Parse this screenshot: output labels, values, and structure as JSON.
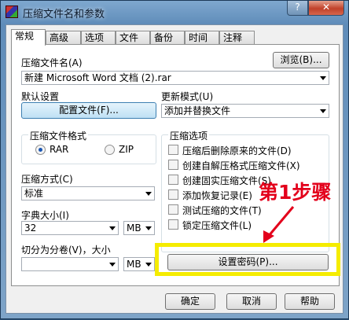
{
  "window": {
    "title": "压缩文件名和参数",
    "help_label": "?",
    "close_label": "✕"
  },
  "tabs": [
    {
      "label": "常规",
      "active": true
    },
    {
      "label": "高级"
    },
    {
      "label": "选项"
    },
    {
      "label": "文件"
    },
    {
      "label": "备份"
    },
    {
      "label": "时间"
    },
    {
      "label": "注释"
    }
  ],
  "general": {
    "archive_name_label": "压缩文件名(A)",
    "browse_label": "浏览(B)...",
    "archive_name_value": "新建 Microsoft Word 文档 (2).rar",
    "default_settings_label": "默认设置",
    "profiles_label": "配置文件(F)...",
    "update_mode_label": "更新模式(U)",
    "update_mode_value": "添加并替换文件",
    "format_group_title": "压缩文件格式",
    "format_rar": "RAR",
    "format_zip": "ZIP",
    "options_group_title": "压缩选项",
    "options": [
      {
        "label": "压缩后删除原来的文件(D)",
        "checked": false
      },
      {
        "label": "创建自解压格式压缩文件(X)",
        "checked": false
      },
      {
        "label": "创建固实压缩文件(S)",
        "checked": false
      },
      {
        "label": "添加恢复记录(E)",
        "checked": false
      },
      {
        "label": "测试压缩的文件(T)",
        "checked": false
      },
      {
        "label": "锁定压缩文件(L)",
        "checked": false
      }
    ],
    "method_label": "压缩方式(C)",
    "method_value": "标准",
    "dict_label": "字典大小(I)",
    "dict_value": "32",
    "dict_unit": "MB",
    "split_label": "切分为分卷(V)，大小",
    "split_value": "",
    "split_unit": "MB",
    "set_password_label": "设置密码(P)..."
  },
  "footer": {
    "ok_label": "确定",
    "cancel_label": "取消",
    "help_label": "帮助"
  },
  "annotation": {
    "step_text": "第1步骤",
    "highlight_color": "#f5ec00",
    "text_color": "#e3001b"
  }
}
